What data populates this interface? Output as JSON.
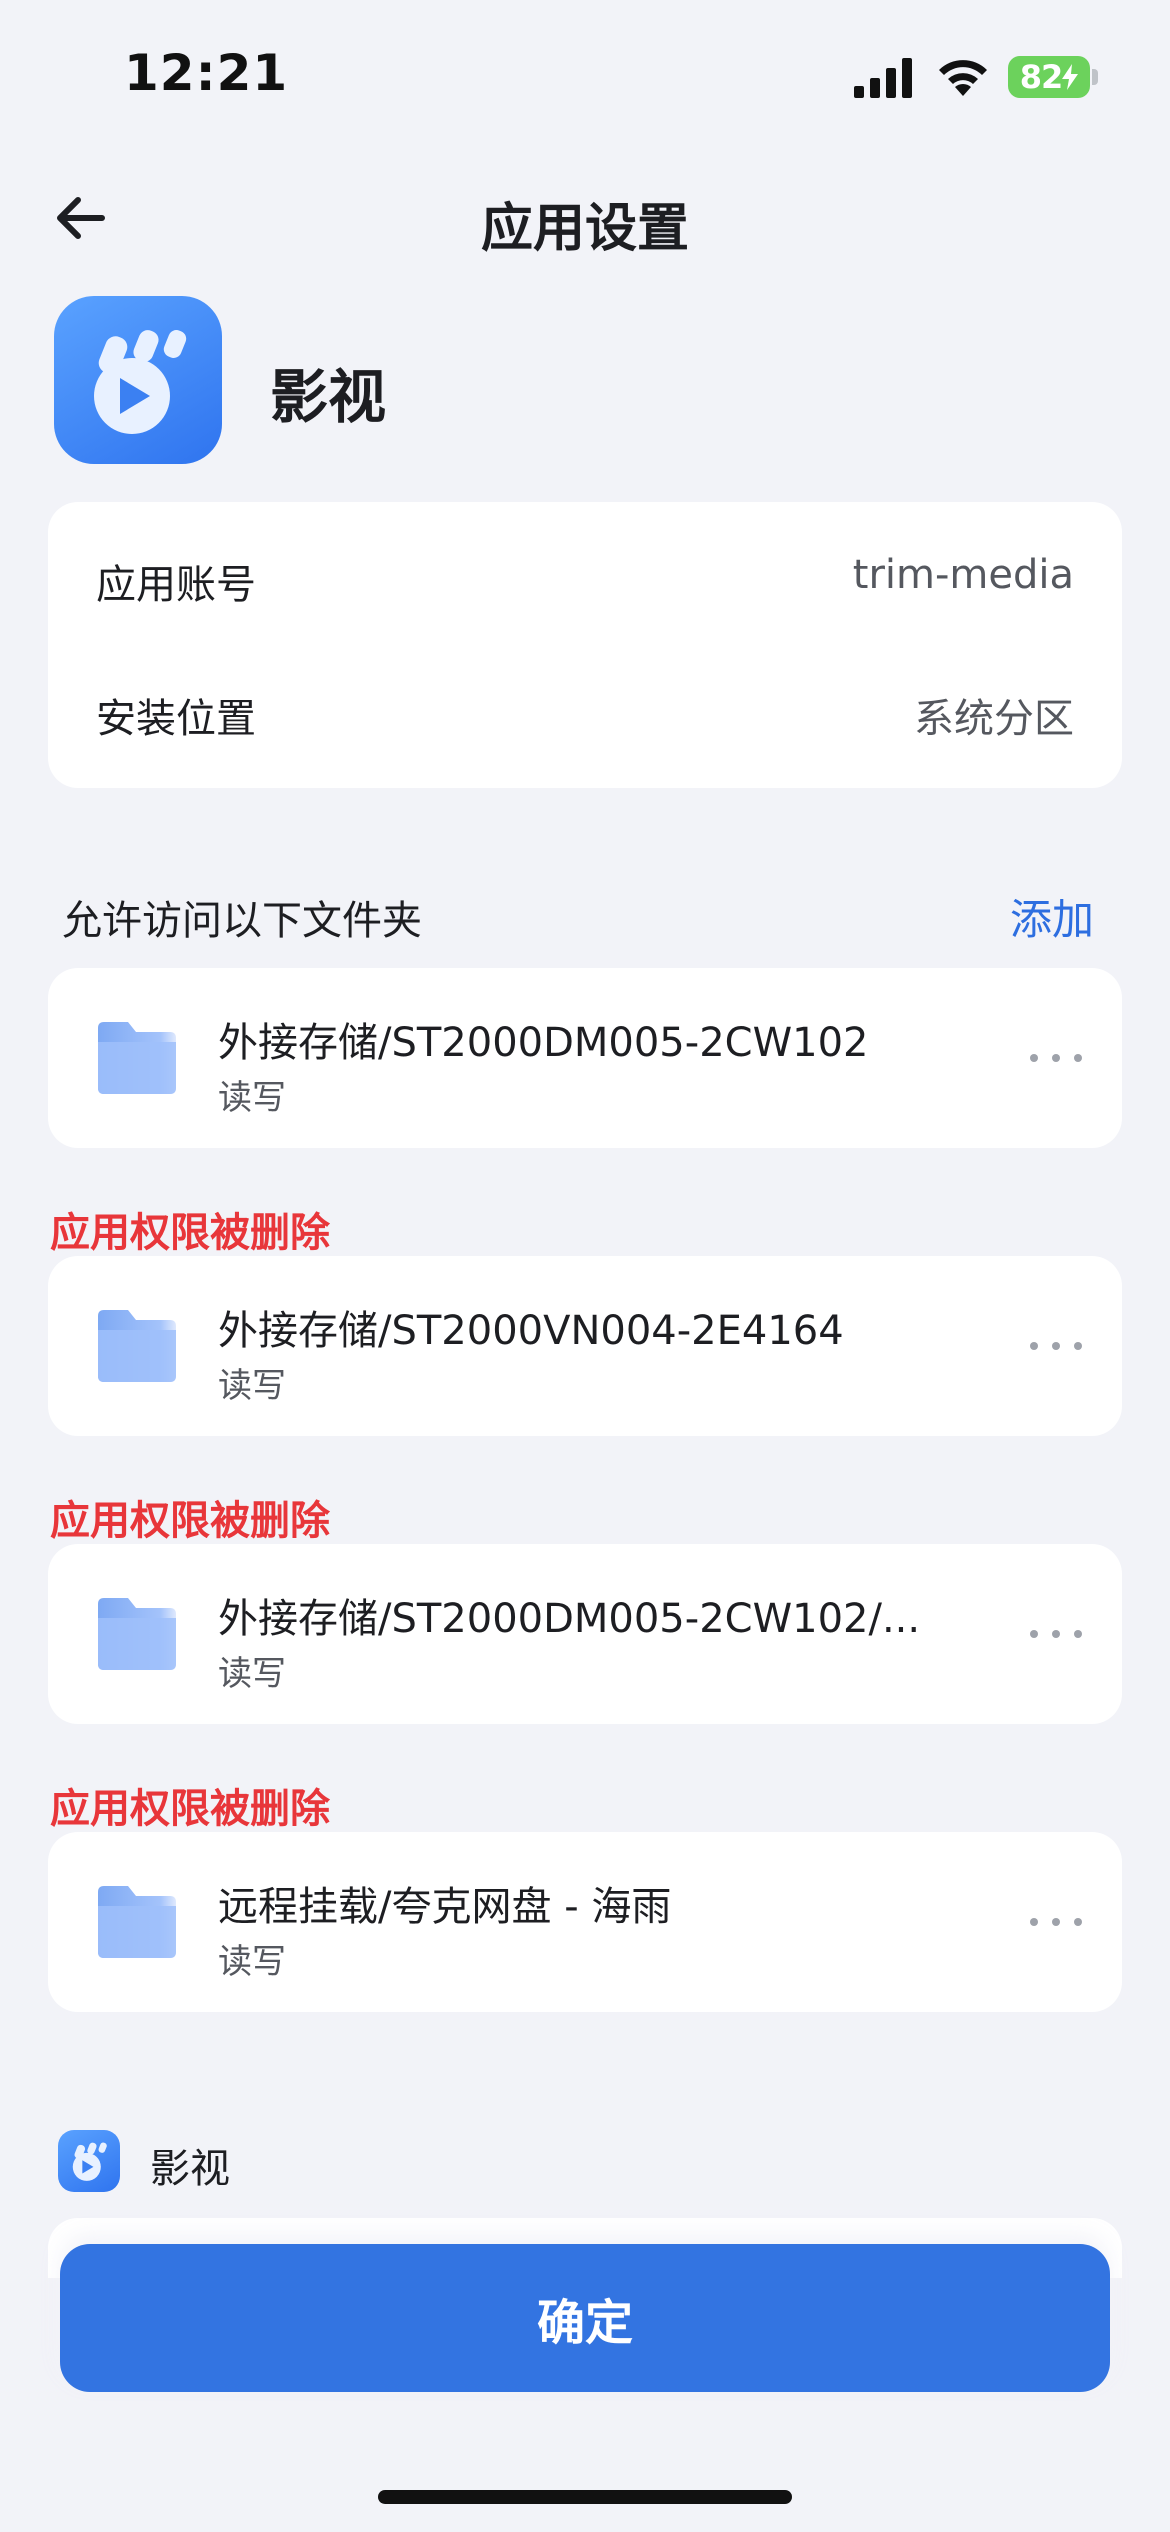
{
  "status_bar": {
    "time": "12:21",
    "battery": "82",
    "icons": [
      "cellular-signal-icon",
      "wifi-icon",
      "battery-charging-icon"
    ]
  },
  "header": {
    "title": "应用设置",
    "back_icon": "arrow-left-icon"
  },
  "app": {
    "name": "影视",
    "icon": "app-video-icon"
  },
  "info_card": {
    "rows": [
      {
        "label": "应用账号",
        "value": "trim-media"
      },
      {
        "label": "安装位置",
        "value": "系统分区"
      }
    ]
  },
  "folders_section": {
    "label": "允许访问以下文件夹",
    "add_label": "添加",
    "warning_text": "应用权限被删除",
    "items": [
      {
        "path": "外接存储/ST2000DM005-2CW102",
        "permission": "读写"
      },
      {
        "path": "外接存储/ST2000VN004-2E4164",
        "permission": "读写"
      },
      {
        "path": "外接存储/ST2000DM005-2CW102/...",
        "permission": "读写"
      },
      {
        "path": "远程挂载/夸克网盘 - 海雨",
        "permission": "读写"
      }
    ]
  },
  "bottom_app": {
    "name": "影视"
  },
  "confirm_label": "确定",
  "colors": {
    "accent": "#3374e1",
    "warning": "#e8363a",
    "background": "#f2f3f8",
    "folder": "#8fb6f7",
    "battery": "#6cd25c"
  }
}
